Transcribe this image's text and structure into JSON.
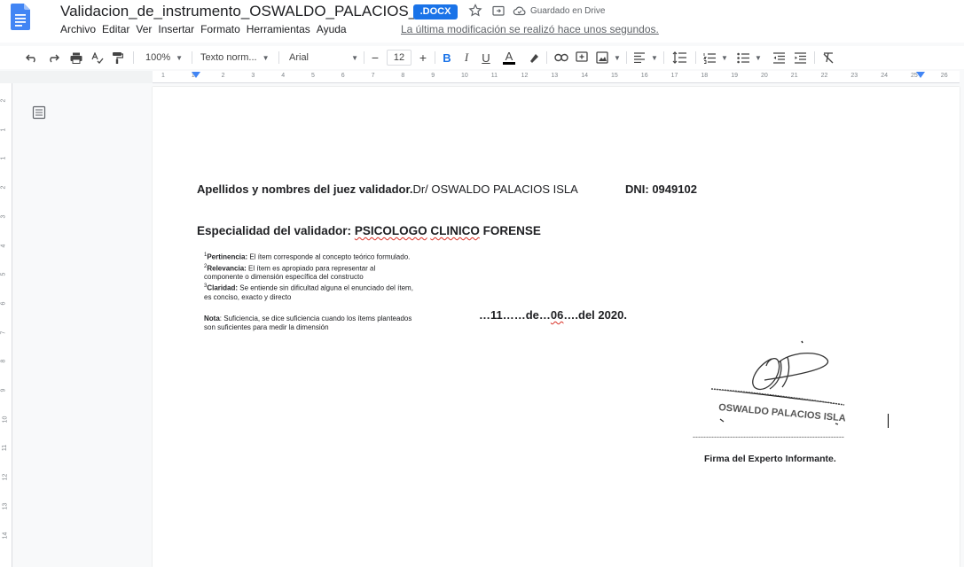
{
  "title": {
    "doc_name": "Validacion_de_instrumento_OSWALDO_PALACIOS_ISLA",
    "badge": ".DOCX",
    "save_status": "Guardado en Drive"
  },
  "menu": [
    "Archivo",
    "Editar",
    "Ver",
    "Insertar",
    "Formato",
    "Herramientas",
    "Ayuda"
  ],
  "last_modified": "La última modificación se realizó hace unos segundos.",
  "toolbar": {
    "zoom": "100%",
    "style": "Texto norm...",
    "font": "Arial",
    "font_size": "12"
  },
  "ruler_numbers": [
    "1",
    "1",
    "2",
    "3",
    "4",
    "5",
    "6",
    "7",
    "8",
    "9",
    "10",
    "11",
    "12",
    "13",
    "14",
    "15",
    "16",
    "17",
    "18",
    "19",
    "20",
    "21",
    "22",
    "23",
    "24",
    "25",
    "26"
  ],
  "vruler_numbers": [
    "2",
    "1",
    "1",
    "2",
    "3",
    "4",
    "5",
    "6",
    "7",
    "8",
    "9",
    "10",
    "11",
    "12",
    "13",
    "14"
  ],
  "document": {
    "judge_label": "Apellidos y nombres del juez validador.",
    "judge_name": "Dr/ OSWALDO PALACIOS ISLA",
    "dni": "DNI: 0949102",
    "specialty_label": "Especialidad del validador: ",
    "specialty_word1": "PSICOLOGO",
    "specialty_word2": "CLINICO",
    "specialty_word3": "FORENSE",
    "notes": {
      "pertinencia_num": "1",
      "pertinencia_label": "Pertinencia:",
      "pertinencia_text": "El ítem corresponde al concepto teórico formulado.",
      "relevancia_num": "2",
      "relevancia_label": "Relevancia:",
      "relevancia_text": "El ítem es apropiado para representar al",
      "relevancia_text2": "componente o dimensión específica del constructo",
      "claridad_num": "3",
      "claridad_label": "Claridad:",
      "claridad_text": "Se entiende sin dificultad alguna el enunciado del ítem,",
      "claridad_text2": "es conciso, exacto y directo",
      "nota_label": "Nota",
      "nota_text": ": Suficiencia, se dice suficiencia cuando los ítems planteados",
      "nota_text2": "son suficientes para medir la dimensión"
    },
    "date_part1": "…11……de…",
    "date_month": "06",
    "date_part2": "….del 2020.",
    "signature_stamp": "OSWALDO PALACIOS ISLA",
    "dashes": "---------------------------------------------------------",
    "signature_label": "Firma del Experto Informante."
  }
}
